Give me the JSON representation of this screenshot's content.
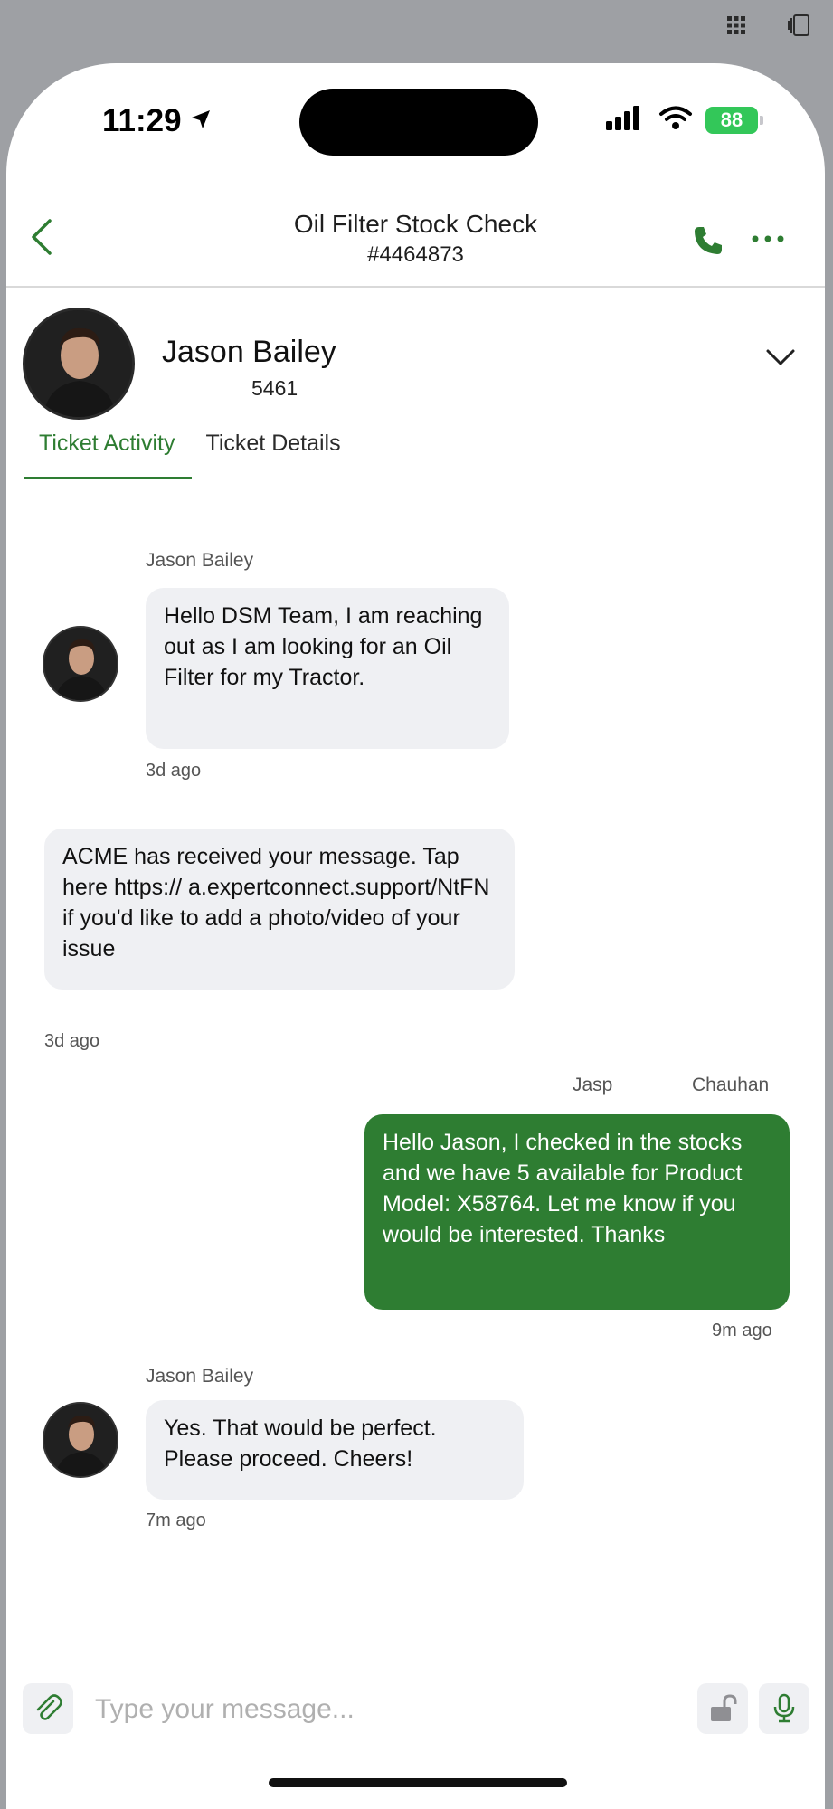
{
  "status_bar": {
    "time": "11:29",
    "battery": "88"
  },
  "header": {
    "title": "Oil Filter Stock Check",
    "ticket_number": "#4464873"
  },
  "contact": {
    "name": "Jason Bailey",
    "id": "5461"
  },
  "tabs": [
    {
      "label": "Ticket Activity",
      "active": true
    },
    {
      "label": "Ticket Details",
      "active": false
    }
  ],
  "messages": [
    {
      "sender": "Jason Bailey",
      "text": "Hello DSM Team, I am reaching out as I am looking for an Oil Filter for my Tractor.",
      "time": "3d ago",
      "direction": "in"
    },
    {
      "sender": "",
      "text": "ACME has received your message. Tap here https:// a.expertconnect.support/NtFN if you'd like to add a photo/video of your issue",
      "time": "3d ago",
      "direction": "in"
    },
    {
      "sender": "Jasp",
      "sender_last": "Chauhan",
      "text": "Hello Jason, I checked in the stocks and we have 5 available for Product Model: X58764. Let me know if you would be interested. Thanks",
      "time": "9m ago",
      "direction": "out"
    },
    {
      "sender": "Jason Bailey",
      "text": "Yes. That would be perfect. Please proceed. Cheers!",
      "time": "7m ago",
      "direction": "in"
    }
  ],
  "composer": {
    "placeholder": "Type your message..."
  },
  "colors": {
    "accent": "#2e7d32",
    "incoming_bubble": "#eff0f3",
    "battery": "#33c759"
  },
  "icons": [
    "grid-icon",
    "sidebar-icon",
    "location-arrow-icon",
    "signal-icon",
    "wifi-icon",
    "back-chevron-icon",
    "phone-icon",
    "more-icon",
    "chevron-down-icon",
    "paperclip-icon",
    "unlock-icon",
    "microphone-icon"
  ]
}
